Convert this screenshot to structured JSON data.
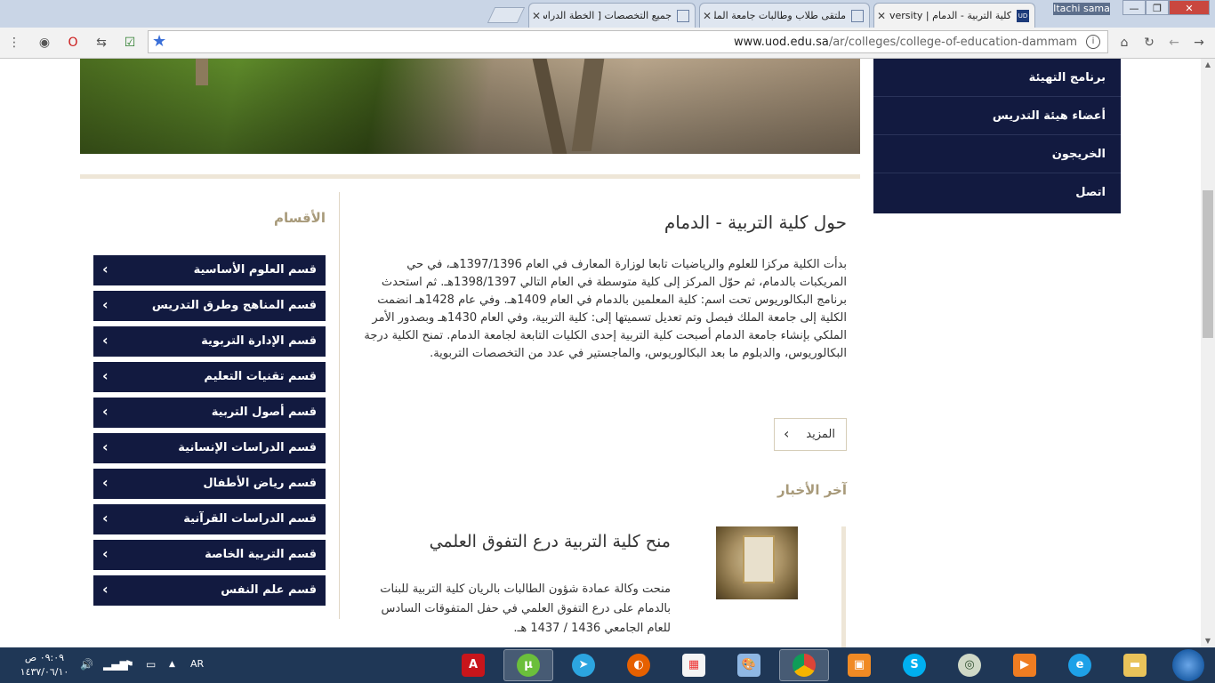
{
  "browser": {
    "tabs": [
      {
        "label": "كلية التربية - الدمام | University",
        "active": true
      },
      {
        "label": "ملتقى طلاب وطالبات جامعة الملك",
        "active": false
      },
      {
        "label": "جميع التخصصات [ الخطة الدراسية",
        "active": false
      }
    ],
    "user": "Itachi sama",
    "favicon_text": "UD",
    "url_host": "www.uod.edu.sa",
    "url_path": "/ar/colleges/college-of-education-dammam"
  },
  "top_menu": {
    "items": [
      "برنامج التهيئة",
      "أعضاء هيئة التدريس",
      "الخريجون",
      "اتصل"
    ]
  },
  "departments": {
    "title": "الأقسام",
    "items": [
      "قسم العلوم الأساسية",
      "قسم المناهج وطرق التدريس",
      "قسم الإدارة التربوية",
      "قسم تقنيات التعليم",
      "قسم أصول التربية",
      "قسم الدراسات الإنسانية",
      "قسم رياض الأطفال",
      "قسم الدراسات القرآنية",
      "قسم التربية الخاصة",
      "قسم علم النفس"
    ]
  },
  "about": {
    "title": "حول كلية التربية - الدمام",
    "text": "بدأت الكلية مركزا للعلوم والرياضيات تابعا لوزارة المعارف في العام 1397/1396هـ، في حي المريكبات بالدمام، ثم حوّل المركز إلى كلية متوسطة في العام التالي 1398/1397هـ. ثم استحدث برنامج البكالوريوس تحت اسم: كلية المعلمين بالدمام في العام 1409هـ. وفي عام 1428هـ انضمت الكلية إلى جامعة الملك فيصل وتم تعديل تسميتها إلى: كلية التربية، وفي العام 1430هـ وبصدور الأمر الملكي بإنشاء جامعة الدمام أصبحت كلية التربية إحدى الكليات التابعة لجامعة الدمام. تمنح الكلية درجة البكالوريوس، والدبلوم ما بعد البكالوريوس، والماجستير في عدد من التخصصات التربوية.",
    "more_label": "المزيد"
  },
  "news": {
    "title": "آخر الأخبار",
    "item_title": "منح كلية التربية درع التفوق العلمي",
    "item_text": "منحت وكالة عمادة شؤون الطالبات بالريان كلية التربية للبنات بالدمام على درع التفوق العلمي في حفل المتفوقات السادس للعام الجامعي 1436 / 1437 هـ."
  },
  "taskbar": {
    "time": "٠٩:٠٩ ص",
    "date": "١٤٣٧/٠٦/١٠",
    "lang": "AR"
  }
}
